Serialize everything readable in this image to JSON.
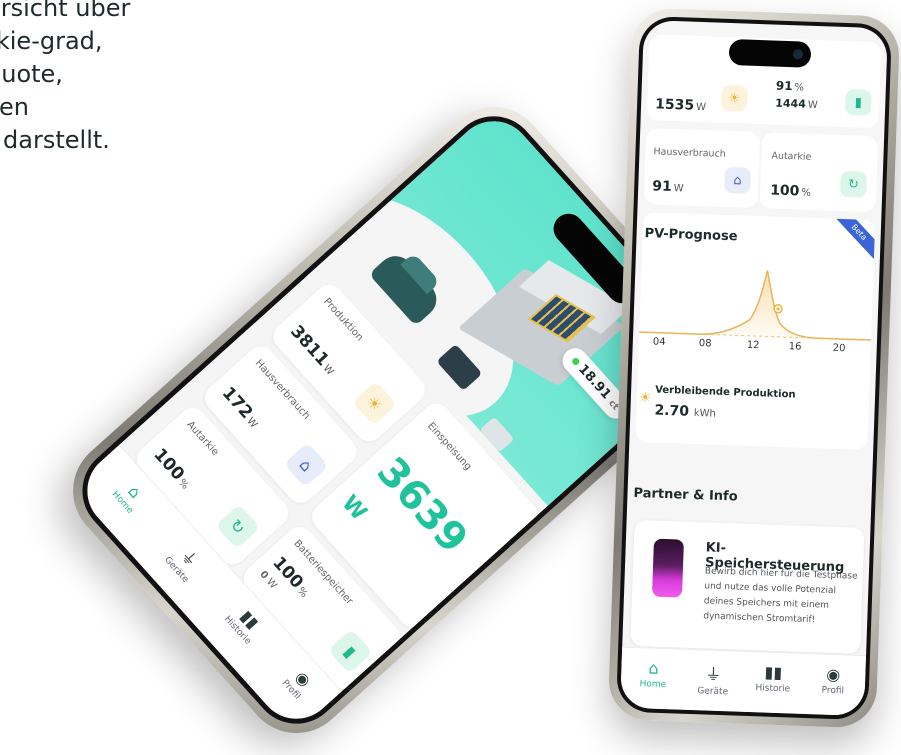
{
  "marketing": {
    "line1": "ersicht über",
    "line2": "rkie-grad,",
    "line3": "quote,",
    "line4": "ken",
    "line5": "t darstellt."
  },
  "phone1": {
    "price_value": "18.91",
    "price_unit": "ct",
    "einspeisung_label": "Einspeisung",
    "einspeisung_value": "3639",
    "einspeisung_unit": "W",
    "produktion_label": "Produktion",
    "produktion_value": "3811",
    "produktion_unit": "W",
    "hausverbrauch_label": "Hausverbrauch",
    "hausverbrauch_value": "172",
    "hausverbrauch_unit": "W",
    "batterie_label": "Batteriespeicher",
    "batterie_value": "100",
    "batterie_unit": "%",
    "batterie_sub_value": "0",
    "batterie_sub_unit": "W",
    "autarkie_label": "Autarkie",
    "autarkie_value": "100",
    "autarkie_unit": "%",
    "nav": {
      "home": "Home",
      "geraete": "Geräte",
      "historie": "Historie",
      "profil": "Profil"
    }
  },
  "phone2": {
    "top_production_value": "1535",
    "top_production_unit": "W",
    "top_battery_value": "91",
    "top_battery_unit": "%",
    "top_battery_sub_value": "1444",
    "top_battery_sub_unit": "W",
    "hausverbrauch_label": "Hausverbrauch",
    "hausverbrauch_value": "91",
    "hausverbrauch_unit": "W",
    "autarkie_label": "Autarkie",
    "autarkie_value": "100",
    "autarkie_unit": "%",
    "prognose_title": "PV-Prognose",
    "beta_label": "Beta",
    "x_ticks": [
      "04",
      "08",
      "12",
      "16",
      "20"
    ],
    "remaining_label": "Verbleibende Produktion",
    "remaining_value": "2.70",
    "remaining_unit": "kWh",
    "partner_title": "Partner & Info",
    "ki_title": "KI-Speichersteuerung",
    "ki_text": "Bewirb dich hier für die Testphase und nutze das volle Potenzial deines Speichers mit einem dynamischen Stromtarif!",
    "nav": {
      "home": "Home",
      "geraete": "Geräte",
      "historie": "Historie",
      "profil": "Profil"
    }
  },
  "colors": {
    "accent": "#1fb98e",
    "hero": "#5fe3cc",
    "sun": "#f3b23c",
    "battery": "#d63ad8",
    "beta": "#3a64d8"
  },
  "icons": {
    "home": "home-icon",
    "devices": "plug-icon",
    "history": "bar-chart-icon",
    "profile": "profile-icon",
    "sun": "sun-icon",
    "battery": "battery-icon",
    "autarky": "cycle-icon"
  }
}
